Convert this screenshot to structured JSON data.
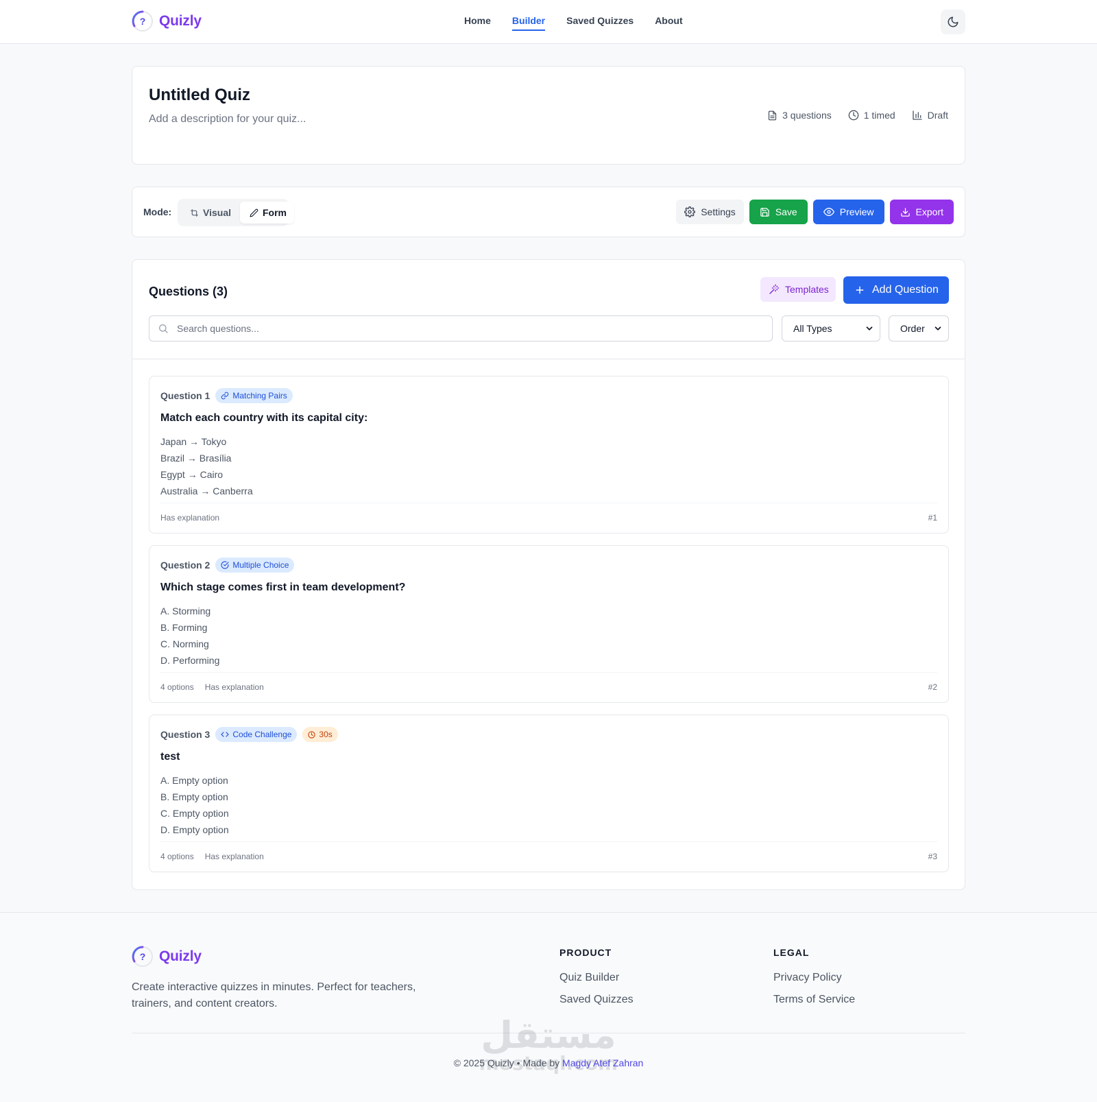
{
  "nav": {
    "brand": "Quizly",
    "links": [
      "Home",
      "Builder",
      "Saved Quizzes",
      "About"
    ],
    "active": "Builder"
  },
  "quiz": {
    "title": "Untitled Quiz",
    "description_placeholder": "Add a description for your quiz...",
    "meta": {
      "questions": "3 questions",
      "timed": "1 timed",
      "status": "Draft"
    }
  },
  "toolbar": {
    "mode_label": "Mode:",
    "mode_visual": "Visual",
    "mode_form": "Form",
    "active_mode": "Form",
    "settings": "Settings",
    "save": "Save",
    "preview": "Preview",
    "export": "Export"
  },
  "questions": {
    "header": "Questions (3)",
    "templates": "Templates",
    "add": "Add Question",
    "search_placeholder": "Search questions...",
    "type_filter": "All Types",
    "sort": "Order",
    "items": [
      {
        "label": "Question 1",
        "type": "Matching Pairs",
        "type_icon": "link-icon",
        "text": "Match each country with its capital city:",
        "options": [
          "Japan → Tokyo",
          "Brazil → Brasília",
          "Egypt → Cairo",
          "Australia → Canberra"
        ],
        "footer": [
          "Has explanation"
        ],
        "index": "#1"
      },
      {
        "label": "Question 2",
        "type": "Multiple Choice",
        "type_icon": "check-circle-icon",
        "text": "Which stage comes first in team development?",
        "options": [
          "A. Storming",
          "B. Forming",
          "C. Norming",
          "D. Performing"
        ],
        "footer": [
          "4 options",
          "Has explanation"
        ],
        "index": "#2"
      },
      {
        "label": "Question 3",
        "type": "Code Challenge",
        "type_icon": "code-icon",
        "timer": "30s",
        "text": "test",
        "options": [
          "A. Empty option",
          "B. Empty option",
          "C. Empty option",
          "D. Empty option"
        ],
        "footer": [
          "4 options",
          "Has explanation"
        ],
        "index": "#3"
      }
    ]
  },
  "footer": {
    "brand": "Quizly",
    "description": "Create interactive quizzes in minutes. Perfect for teachers, trainers, and content creators.",
    "product_heading": "PRODUCT",
    "product_links": [
      "Quiz Builder",
      "Saved Quizzes"
    ],
    "legal_heading": "LEGAL",
    "legal_links": [
      "Privacy Policy",
      "Terms of Service"
    ],
    "copyright": "© 2025 Quizly • Made by",
    "author": "Magdy Atef Zahran",
    "watermark_text": "مستقل",
    "watermark_domain": "mostaql.com"
  },
  "colors": {
    "primary": "#2563eb",
    "brand_purple": "#7c3aed",
    "save_green": "#16a34a",
    "export_purple": "#9333ea",
    "templates_bg": "#f3e8ff"
  }
}
